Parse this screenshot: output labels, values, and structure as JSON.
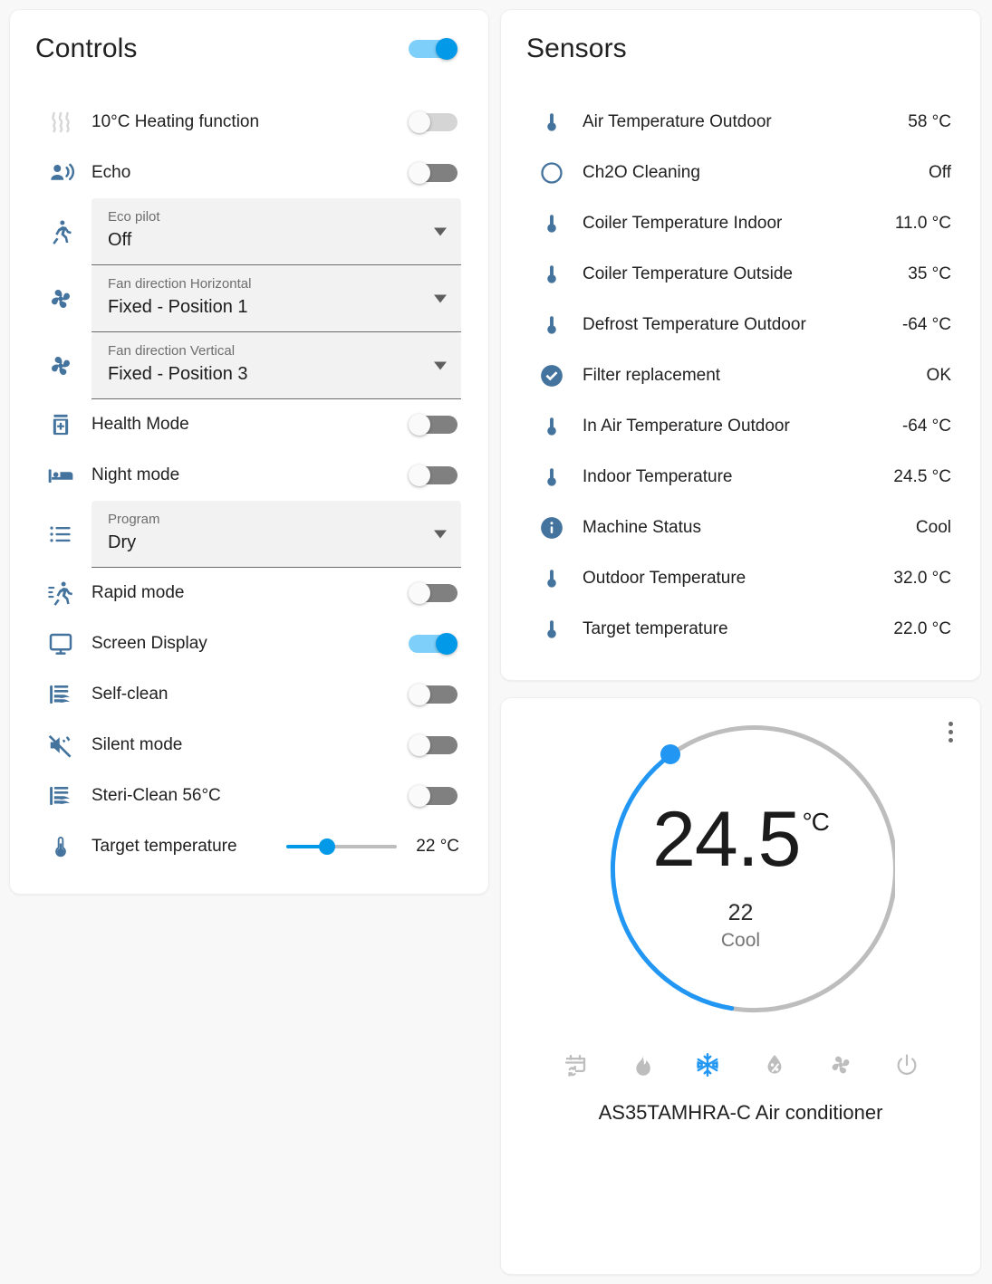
{
  "controls": {
    "title": "Controls",
    "master_toggle": {
      "name": "master-power-toggle",
      "state": "on"
    },
    "items": [
      {
        "icon": "heat-wave-icon",
        "label": "10°C Heating function",
        "type": "toggle",
        "state": "off",
        "disabled": true
      },
      {
        "icon": "echo-voice-icon",
        "label": "Echo",
        "type": "toggle",
        "state": "off",
        "disabled": false
      },
      {
        "icon": "running-person-icon",
        "label": "Eco pilot",
        "type": "select",
        "value": "Off"
      },
      {
        "icon": "fan-icon",
        "label": "Fan direction Horizontal",
        "type": "select",
        "value": "Fixed - Position 1"
      },
      {
        "icon": "fan-icon",
        "label": "Fan direction Vertical",
        "type": "select",
        "value": "Fixed - Position 3"
      },
      {
        "icon": "health-jar-icon",
        "label": "Health Mode",
        "type": "toggle",
        "state": "off",
        "disabled": false
      },
      {
        "icon": "bed-icon",
        "label": "Night mode",
        "type": "toggle",
        "state": "off",
        "disabled": false
      },
      {
        "icon": "list-icon",
        "label": "Program",
        "type": "select",
        "value": "Dry"
      },
      {
        "icon": "running-fast-icon",
        "label": "Rapid mode",
        "type": "toggle",
        "state": "off",
        "disabled": false
      },
      {
        "icon": "monitor-icon",
        "label": "Screen Display",
        "type": "toggle",
        "state": "on",
        "disabled": false
      },
      {
        "icon": "air-filter-icon",
        "label": "Self-clean",
        "type": "toggle",
        "state": "off",
        "disabled": false
      },
      {
        "icon": "volume-mute-icon",
        "label": "Silent mode",
        "type": "toggle",
        "state": "off",
        "disabled": false
      },
      {
        "icon": "air-filter-icon",
        "label": "Steri-Clean 56°C",
        "type": "toggle",
        "state": "off",
        "disabled": false
      },
      {
        "icon": "thermometer-icon",
        "label": "Target temperature",
        "type": "slider",
        "value": "22 °C",
        "percent": 30
      }
    ]
  },
  "sensors": {
    "title": "Sensors",
    "items": [
      {
        "icon": "thermometer-icon",
        "name": "Air Temperature Outdoor",
        "value": "58 °C"
      },
      {
        "icon": "circle-outline-icon",
        "name": "Ch2O Cleaning",
        "value": "Off"
      },
      {
        "icon": "thermometer-icon",
        "name": "Coiler Temperature Indoor",
        "value": "11.0 °C"
      },
      {
        "icon": "thermometer-icon",
        "name": "Coiler Temperature Outside",
        "value": "35 °C"
      },
      {
        "icon": "thermometer-icon",
        "name": "Defrost Temperature Outdoor",
        "value": "-64 °C"
      },
      {
        "icon": "check-circle-icon",
        "name": "Filter replacement",
        "value": "OK"
      },
      {
        "icon": "thermometer-icon",
        "name": "In Air Temperature Outdoor",
        "value": "-64 °C"
      },
      {
        "icon": "thermometer-icon",
        "name": "Indoor Temperature",
        "value": "24.5 °C"
      },
      {
        "icon": "info-circle-icon",
        "name": "Machine Status",
        "value": "Cool"
      },
      {
        "icon": "thermometer-icon",
        "name": "Outdoor Temperature",
        "value": "32.0 °C"
      },
      {
        "icon": "thermometer-icon",
        "name": "Target temperature",
        "value": "22.0 °C"
      }
    ]
  },
  "thermostat": {
    "current_temperature": "24.5",
    "unit": "°C",
    "target_temperature": "22",
    "mode_label": "Cool",
    "device_name": "AS35TAMHRA-C Air conditioner",
    "menu": "more-options",
    "modes": [
      {
        "icon": "calendar-sync-icon",
        "name": "auto",
        "active": false
      },
      {
        "icon": "fire-icon",
        "name": "heat",
        "active": false
      },
      {
        "icon": "snowflake-icon",
        "name": "cool",
        "active": true
      },
      {
        "icon": "water-percent-icon",
        "name": "dry",
        "active": false
      },
      {
        "icon": "fan-icon",
        "name": "fan-only",
        "active": false
      },
      {
        "icon": "power-icon",
        "name": "off",
        "active": false
      }
    ],
    "arc": {
      "start_deg": -30,
      "active_color": "#2196f3",
      "track_color": "#bdbdbd"
    }
  },
  "colors": {
    "accent": "#029ae8",
    "icon_blue": "#44739e",
    "dial_blue": "#2196f3",
    "page_bg": "#f8f8f8",
    "card_bg": "#ffffff"
  }
}
